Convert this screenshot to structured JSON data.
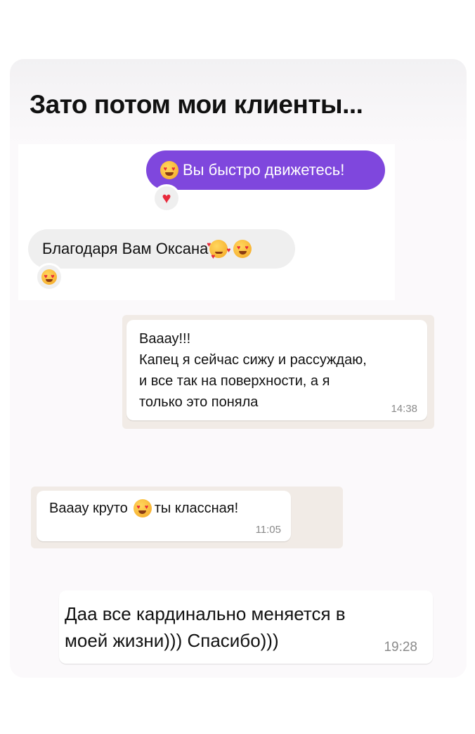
{
  "title": "Зато потом мои клиенты...",
  "instagram": {
    "sent_message": "Вы быстро движетесь!",
    "sent_reaction": "red-heart-icon",
    "received_message": "Благодаря Вам Оксана",
    "received_reaction": "heart-eyes-emoji-icon"
  },
  "whatsapp": [
    {
      "lines": [
        "Вааау!!!",
        "Капец я сейчас сижу и рассуждаю,",
        "и все так на поверхности, а я",
        "только это поняла"
      ],
      "time": "14:38"
    },
    {
      "text_before": "Вааау круто",
      "text_after": "ты классная!",
      "time": "11:05"
    },
    {
      "lines": [
        "Даа все кардинально меняется в",
        "моей жизни))) Спасибо)))"
      ],
      "time": "19:28"
    }
  ],
  "colors": {
    "instagram_sent": "#7f47dd",
    "instagram_received": "#efefef",
    "whatsapp_bg": "#ece5dd"
  }
}
